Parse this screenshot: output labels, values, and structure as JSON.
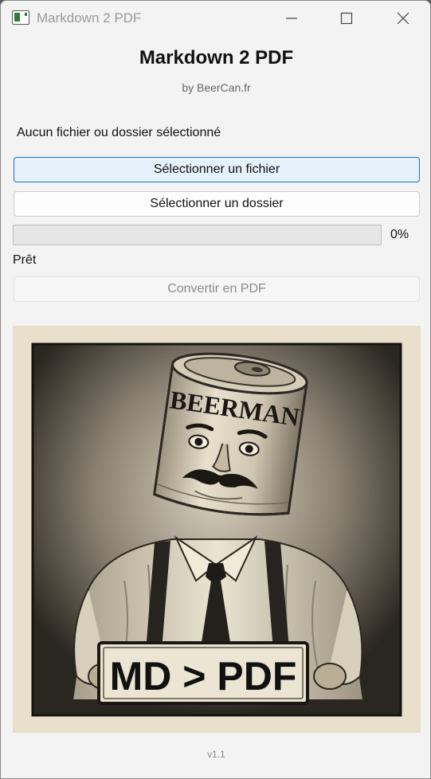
{
  "window": {
    "title": "Markdown 2 PDF"
  },
  "header": {
    "title": "Markdown 2 PDF",
    "subtitle": "by BeerCan.fr"
  },
  "selection_status": "Aucun fichier ou dossier sélectionné",
  "buttons": {
    "select_file": "Sélectionner un fichier",
    "select_folder": "Sélectionner un dossier",
    "convert": "Convertir en PDF"
  },
  "progress": {
    "value": 0,
    "label": "0%"
  },
  "status": "Prêt",
  "illustration": {
    "can_label": "BEERMAN",
    "sign_text": "MD > PDF"
  },
  "version": "v1.1",
  "colors": {
    "accent": "#1b74c8",
    "selected_button_bg": "#e5f1fb",
    "progress_fill": "#06b025",
    "poster_bg": "#e9e0cc"
  }
}
